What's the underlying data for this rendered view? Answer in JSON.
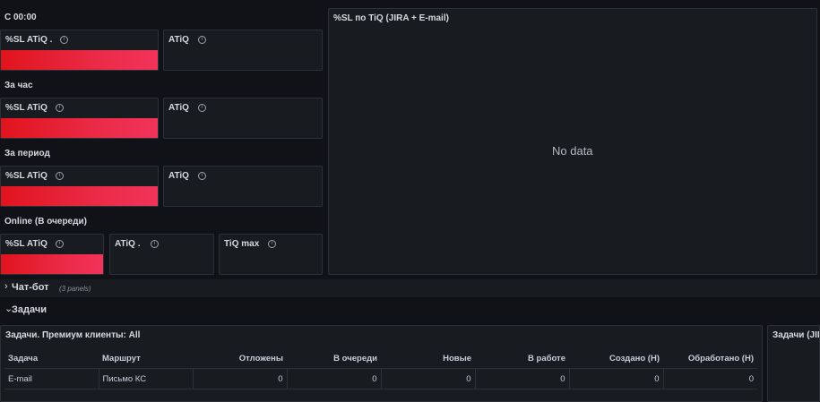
{
  "groups": [
    {
      "title": "С 00:00",
      "panels": [
        "%SL ATiQ .",
        "ATiQ"
      ]
    },
    {
      "title": "За час",
      "panels": [
        "%SL ATiQ",
        "ATiQ"
      ]
    },
    {
      "title": "За период",
      "panels": [
        "%SL ATiQ",
        "ATiQ"
      ]
    },
    {
      "title": "Online (В очереди)",
      "panels": [
        "%SL ATiQ",
        "ATiQ .",
        "TiQ max"
      ]
    }
  ],
  "chart_panel": {
    "title": "%SL по TiQ (JIRA + E-mail)",
    "empty_text": "No data"
  },
  "rows": {
    "chatbot": {
      "label": "Чат-бот",
      "count": "(3 panels)"
    },
    "tasks": {
      "label": "Задачи"
    }
  },
  "tasks_table": {
    "title": "Задачи. Премиум клиенты: All",
    "columns": [
      "Задача",
      "Маршрут",
      "Отложены",
      "В очереди",
      "Новые",
      "В работе",
      "Создано (Н)",
      "Обработано (Н)"
    ],
    "rows": [
      [
        "E-mail",
        "Письмо КС",
        "0",
        "0",
        "0",
        "0",
        "0",
        "0"
      ]
    ]
  },
  "right_panel": {
    "title": "Задачи (JIR"
  },
  "icons": {
    "info": "info-icon",
    "collapsed": "chevron-right-icon",
    "expanded": "chevron-down-icon"
  },
  "colors": {
    "gauge_start": "#e0141d",
    "gauge_end": "#f2335a",
    "background": "#111217",
    "panel": "#181b1f"
  }
}
